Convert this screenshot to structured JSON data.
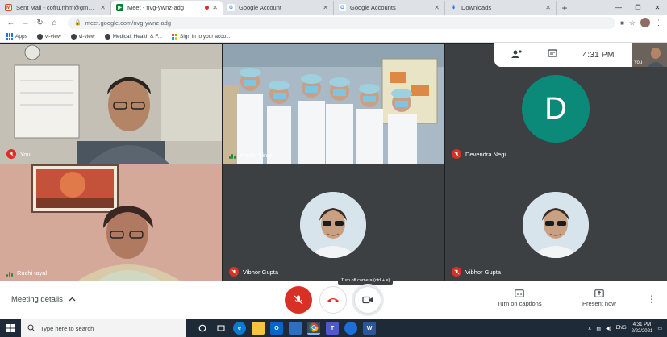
{
  "browser": {
    "tabs": [
      {
        "label": "Sent Mail - cofru.nhm@gmail.c",
        "icon": "gmail-icon",
        "active": false
      },
      {
        "label": "Meet - nvg-ywnz-adg",
        "icon": "meet-icon",
        "active": true
      },
      {
        "label": "Google Account",
        "icon": "google-icon",
        "active": false
      },
      {
        "label": "Google Accounts",
        "icon": "google-icon",
        "active": false
      },
      {
        "label": "Downloads",
        "icon": "download-icon",
        "active": false
      }
    ],
    "new_tab": "+",
    "url": "meet.google.com/nvg-ywnz-adg",
    "bookmarks": [
      {
        "label": "Apps",
        "icon": "apps-icon"
      },
      {
        "label": "vi-view",
        "icon": "globe-icon"
      },
      {
        "label": "vi-view",
        "icon": "globe-icon"
      },
      {
        "label": "Medical, Health & F...",
        "icon": "globe-icon"
      },
      {
        "label": "Sign in to your acco...",
        "icon": "microsoft-icon"
      }
    ]
  },
  "meet": {
    "time": "4:31 PM",
    "self_label": "You",
    "participants": [
      {
        "name": "You",
        "muted": true
      },
      {
        "name": "Prachi Singh",
        "muted": false
      },
      {
        "name": "Devendra Negi",
        "muted": true,
        "initial": "D"
      },
      {
        "name": "Ruchi tayal",
        "muted": false
      },
      {
        "name": "Vibhor Gupta",
        "muted": true
      },
      {
        "name": "Vibhor Gupta",
        "muted": true
      }
    ],
    "meeting_details": "Meeting details",
    "tooltip": "Turn off camera (ctrl + e)",
    "captions_label": "Turn on captions",
    "present_label": "Present now"
  },
  "taskbar": {
    "search_placeholder": "Type here to search",
    "language": "ENG",
    "time": "4:31 PM",
    "date": "2/22/2021"
  },
  "colors": {
    "meet_red": "#d93025",
    "avatar_teal": "#0b8a7a",
    "meet_bg": "#202124"
  }
}
